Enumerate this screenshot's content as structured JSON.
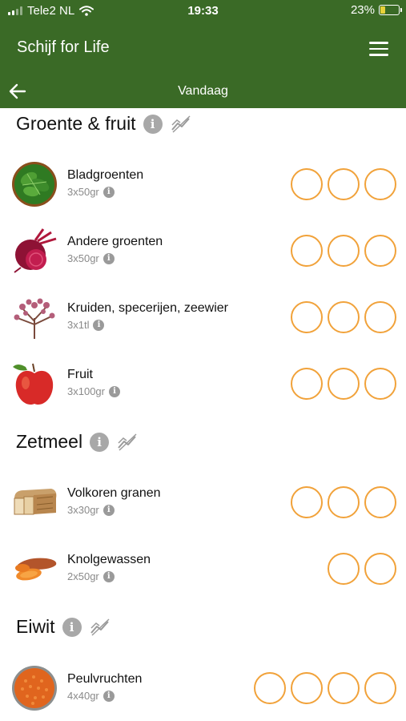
{
  "status_bar": {
    "carrier": "Tele2 NL",
    "time": "19:33",
    "battery": "23%",
    "battery_level": 0.23
  },
  "app_bar": {
    "title": "Schijf for Life",
    "menu_icon": "hamburger-icon"
  },
  "sub_bar": {
    "title": "Vandaag",
    "back_icon": "arrow-left-icon"
  },
  "colors": {
    "header": "#3a6a26",
    "circle_border": "#f1a23a",
    "info_icon": "#a8a8a8"
  },
  "sections": [
    {
      "title": "Groente & fruit",
      "items": [
        {
          "name": "Bladgroenten",
          "portion": "3x50gr",
          "circles": 3,
          "icon": "spinach-icon"
        },
        {
          "name": "Andere groenten",
          "portion": "3x50gr",
          "circles": 3,
          "icon": "beetroot-icon"
        },
        {
          "name": "Kruiden, specerijen, zeewier",
          "portion": "3x1tl",
          "circles": 3,
          "icon": "herbs-icon"
        },
        {
          "name": "Fruit",
          "portion": "3x100gr",
          "circles": 3,
          "icon": "apple-icon"
        }
      ]
    },
    {
      "title": "Zetmeel",
      "items": [
        {
          "name": "Volkoren granen",
          "portion": "3x30gr",
          "circles": 3,
          "icon": "bread-icon"
        },
        {
          "name": "Knolgewassen",
          "portion": "2x50gr",
          "circles": 2,
          "icon": "sweet-potato-icon"
        }
      ]
    },
    {
      "title": "Eiwit",
      "items": [
        {
          "name": "Peulvruchten",
          "portion": "4x40gr",
          "circles": 4,
          "icon": "lentils-icon"
        }
      ]
    }
  ]
}
